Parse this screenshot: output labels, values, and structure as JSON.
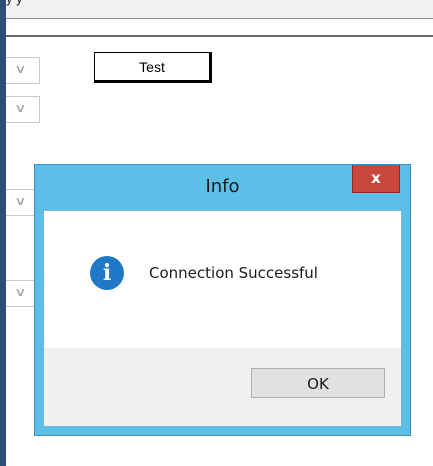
{
  "window": {
    "top_text": "y                                                            y"
  },
  "form": {
    "test_button_label": "Test",
    "combo_chevron": "∨"
  },
  "dialog": {
    "title": "Info",
    "close_label": "x",
    "icon": "info-icon",
    "icon_glyph": "i",
    "message": "Connection Successful",
    "ok_label": "OK"
  },
  "colors": {
    "title_bar": "#5bbfe8",
    "close_button": "#c8473a",
    "info_icon": "#1f78c8",
    "window_border": "#2b4f77"
  }
}
